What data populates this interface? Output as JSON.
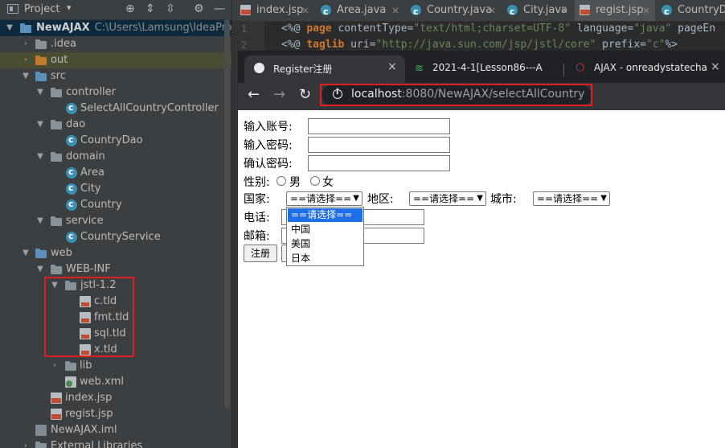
{
  "project_panel": {
    "title": "Project",
    "tree": [
      {
        "label": "NewAJAX",
        "path": "C:\\Users\\Lamsung\\IdeaProject",
        "type": "project",
        "selected": true
      },
      {
        "label": ".idea",
        "type": "folder"
      },
      {
        "label": "out",
        "type": "folder-orange"
      },
      {
        "label": "src",
        "type": "folder-blue"
      },
      {
        "label": "controller",
        "type": "package"
      },
      {
        "label": "SelectAllCountryController",
        "type": "class"
      },
      {
        "label": "dao",
        "type": "package"
      },
      {
        "label": "CountryDao",
        "type": "class"
      },
      {
        "label": "domain",
        "type": "package"
      },
      {
        "label": "Area",
        "type": "class"
      },
      {
        "label": "City",
        "type": "class"
      },
      {
        "label": "Country",
        "type": "class"
      },
      {
        "label": "service",
        "type": "package"
      },
      {
        "label": "CountryService",
        "type": "class"
      },
      {
        "label": "web",
        "type": "folder-web"
      },
      {
        "label": "WEB-INF",
        "type": "folder"
      },
      {
        "label": "jstl-1.2",
        "type": "folder"
      },
      {
        "label": "c.tld",
        "type": "tld"
      },
      {
        "label": "fmt.tld",
        "type": "tld"
      },
      {
        "label": "sql.tld",
        "type": "tld"
      },
      {
        "label": "x.tld",
        "type": "tld"
      },
      {
        "label": "lib",
        "type": "folder"
      },
      {
        "label": "web.xml",
        "type": "xml"
      },
      {
        "label": "index.jsp",
        "type": "jsp"
      },
      {
        "label": "regist.jsp",
        "type": "jsp"
      },
      {
        "label": "NewAJAX.iml",
        "type": "iml"
      },
      {
        "label": "External Libraries",
        "type": "lib"
      }
    ]
  },
  "editor": {
    "tabs": [
      {
        "label": "index.jsp"
      },
      {
        "label": "Area.java"
      },
      {
        "label": "Country.java"
      },
      {
        "label": "City.java"
      },
      {
        "label": "regist.jsp",
        "active": true
      },
      {
        "label": "CountryDa"
      }
    ],
    "line_numbers": [
      "1",
      "2"
    ],
    "line1": {
      "open": "<%@ ",
      "kw": "page",
      "rest1": " contentType=",
      "s1": "\"text/html;charset=UTF-8\"",
      "rest2": " language=",
      "s2": "\"java\"",
      "rest3": " pageEn"
    },
    "line2": {
      "open": "<%@ ",
      "kw": "taglib",
      "rest1": " uri=",
      "s1": "\"http://java.sun.com/jsp/jstl/core\"",
      "rest2": " prefix=",
      "s2": "\"c\"",
      "rest3": "%>"
    }
  },
  "browser": {
    "tabs": [
      {
        "label": "Register注册"
      },
      {
        "label": "2021-4-1[Lesson86---A"
      },
      {
        "label": "AJAX - onreadystatecha"
      }
    ],
    "url_host": "localhost",
    "url_rest": ":8080/NewAJAX/selectAllCountry"
  },
  "form": {
    "account_label": "输入账号:",
    "password_label": "输入密码:",
    "confirm_label": "确认密码:",
    "gender_label": "性别:",
    "male": "男",
    "female": "女",
    "country_label": "国家:",
    "area_label": "地区:",
    "city_label": "城市:",
    "select_default": "==请选择==",
    "phone_label": "电话:",
    "email_label": "邮箱:",
    "submit_button": "注册",
    "country_options": [
      "==请选择==",
      "中国",
      "美国",
      "日本"
    ]
  }
}
